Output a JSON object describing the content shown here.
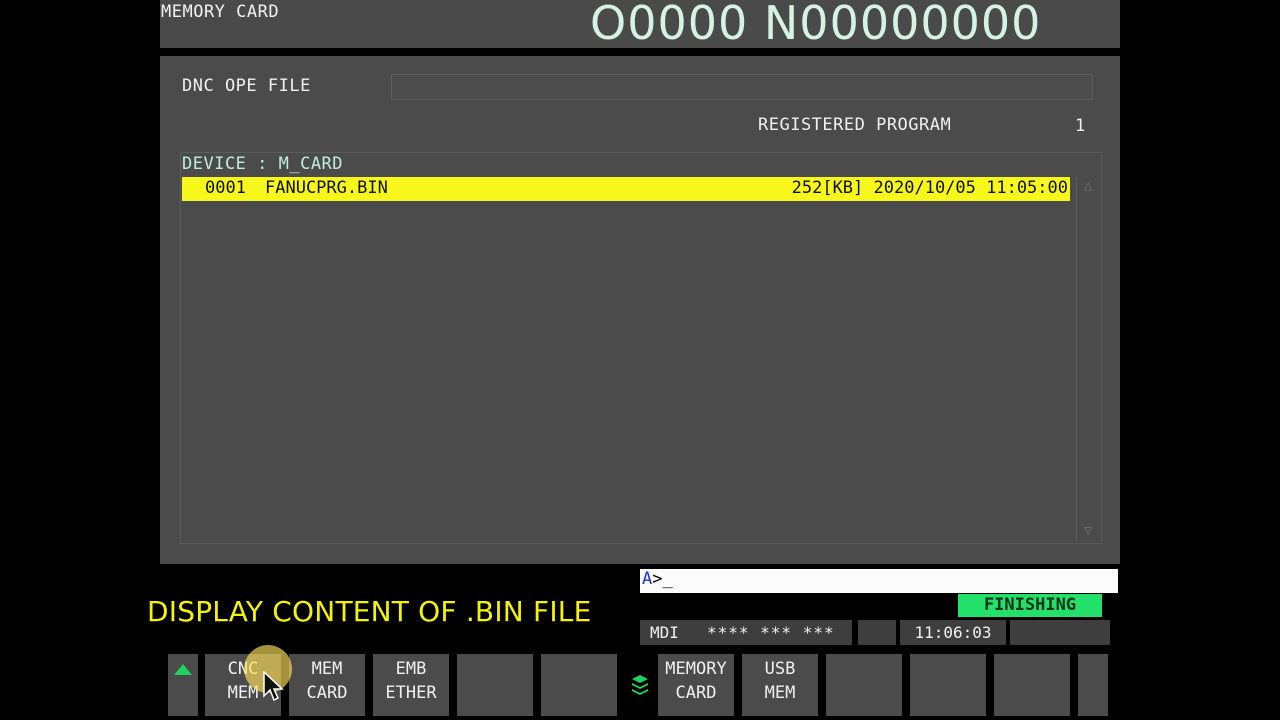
{
  "header": {
    "screen_title": "MEMORY CARD",
    "program_number": "O0000 N00000000"
  },
  "main": {
    "dnc_label": "DNC OPE FILE",
    "dnc_value": "",
    "registered_label": "REGISTERED PROGRAM",
    "registered_count": "1",
    "device_label": "DEVICE : M_CARD",
    "files": [
      {
        "number": "0001",
        "name": "FANUCPRG.BIN",
        "size": "252[KB]",
        "date": "2020/10/05 11:05:00"
      }
    ]
  },
  "command_line": {
    "drive": "A",
    "prompt": ">_"
  },
  "caption": "DISPLAY CONTENT OF .BIN FILE",
  "status": {
    "finishing": "FINISHING",
    "mode": "MDI",
    "stars": "**** *** ***",
    "clock": "11:06:03"
  },
  "softkeys": {
    "left": [
      {
        "l1": "CNC",
        "l2": "MEM"
      },
      {
        "l1": "MEM",
        "l2": "CARD"
      },
      {
        "l1": "EMB",
        "l2": "ETHER"
      },
      {
        "l1": "",
        "l2": ""
      },
      {
        "l1": "",
        "l2": ""
      }
    ],
    "right": [
      {
        "l1": "MEMORY",
        "l2": "CARD"
      },
      {
        "l1": "USB",
        "l2": "MEM"
      },
      {
        "l1": "",
        "l2": ""
      },
      {
        "l1": "",
        "l2": ""
      },
      {
        "l1": "",
        "l2": ""
      }
    ]
  },
  "colors": {
    "highlight_row": "#f7f71c",
    "finishing_badge": "#22e06a",
    "caption_text": "#f4f400",
    "panel": "#4b4b4b"
  },
  "icons": {
    "page_up": "triangle-up-icon",
    "mid_separator": "layers-icon",
    "cursor": "mouse-pointer-icon",
    "scroll_up": "scroll-up-arrow-icon",
    "scroll_down": "scroll-down-arrow-icon"
  }
}
